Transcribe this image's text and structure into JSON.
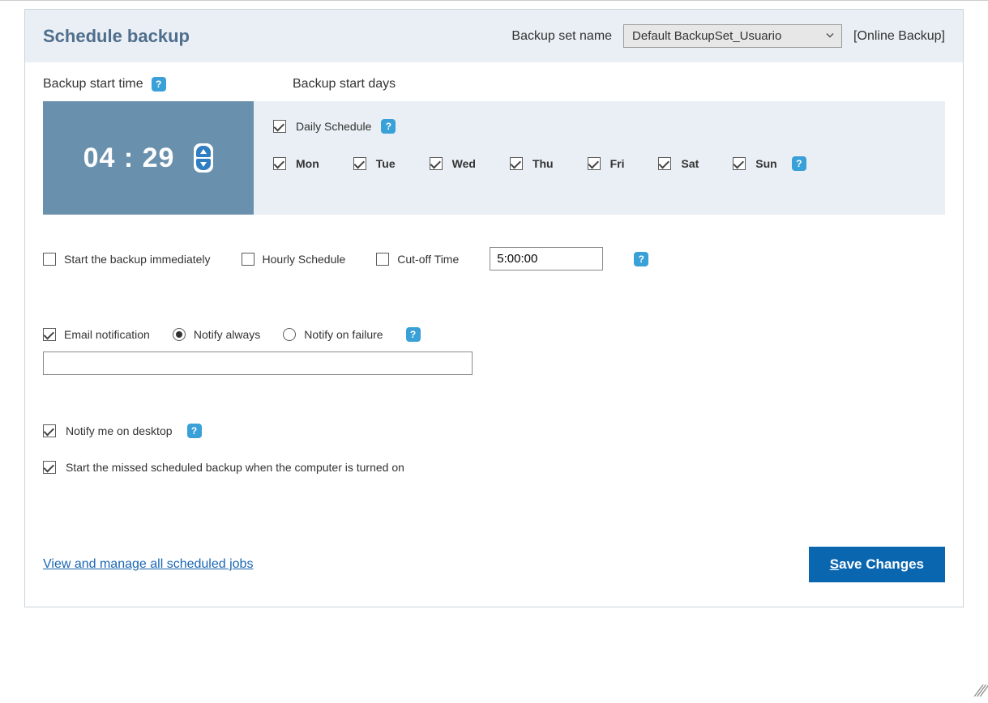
{
  "header": {
    "title": "Schedule backup",
    "backup_set_label": "Backup set name",
    "backup_set_selected": "Default BackupSet_Usuario",
    "backup_mode": "[Online Backup]"
  },
  "legend": {
    "start_time": "Backup start time",
    "start_days": "Backup start days"
  },
  "time": {
    "value": "04 : 29"
  },
  "daily_schedule": {
    "label": "Daily Schedule",
    "checked": true
  },
  "days": [
    {
      "label": "Mon",
      "checked": true
    },
    {
      "label": "Tue",
      "checked": true
    },
    {
      "label": "Wed",
      "checked": true
    },
    {
      "label": "Thu",
      "checked": true
    },
    {
      "label": "Fri",
      "checked": true
    },
    {
      "label": "Sat",
      "checked": true
    },
    {
      "label": "Sun",
      "checked": true
    }
  ],
  "options": {
    "start_immediately": {
      "label": "Start the backup immediately",
      "checked": false
    },
    "hourly": {
      "label": "Hourly Schedule",
      "checked": false
    },
    "cutoff": {
      "label": "Cut-off Time",
      "checked": false,
      "value": "5:00:00"
    }
  },
  "email": {
    "enable": {
      "label": "Email notification",
      "checked": true
    },
    "always": {
      "label": "Notify always",
      "selected": true
    },
    "on_failure": {
      "label": "Notify on failure",
      "selected": false
    },
    "address": ""
  },
  "desktop_notify": {
    "label": "Notify me on desktop",
    "checked": true
  },
  "missed_backup": {
    "label": "Start the missed scheduled backup when the computer is turned on",
    "checked": true
  },
  "footer": {
    "manage_link": "View and manage all scheduled jobs",
    "save_prefix": "S",
    "save_rest": "ave Changes"
  },
  "help_char": "?"
}
